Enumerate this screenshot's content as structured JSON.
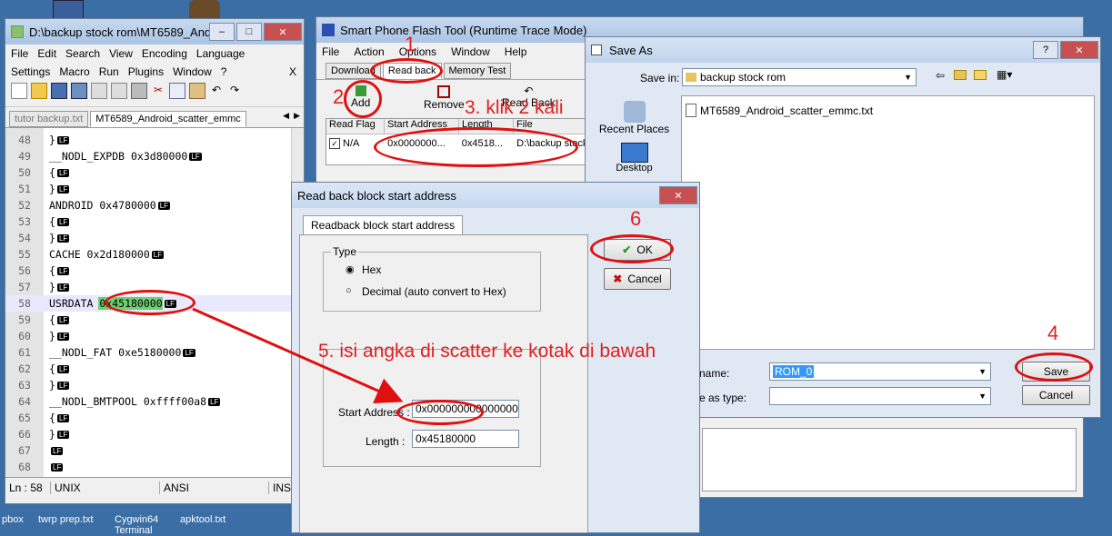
{
  "desktop": {
    "taskbar_labels": [
      "pbox",
      "twrp prep.txt",
      "Cygwin64 Terminal",
      "apktool.txt"
    ]
  },
  "notepad": {
    "title": "D:\\backup stock rom\\MT6589_And...",
    "menu_row1": [
      "File",
      "Edit",
      "Search",
      "View",
      "Encoding",
      "Language"
    ],
    "menu_row2": [
      "Settings",
      "Macro",
      "Run",
      "Plugins",
      "Window",
      "?"
    ],
    "menu_close": "X",
    "tabs": [
      "tutor backup.txt",
      "MT6589_Android_scatter_emmc"
    ],
    "lines": [
      {
        "num": "48",
        "text": "}",
        "lf": "LF"
      },
      {
        "num": "49",
        "text": "__NODL_EXPDB 0x3d80000",
        "lf": "LF"
      },
      {
        "num": "50",
        "text": "{",
        "lf": "LF"
      },
      {
        "num": "51",
        "text": "}",
        "lf": "LF"
      },
      {
        "num": "52",
        "text": "ANDROID 0x4780000",
        "lf": "LF"
      },
      {
        "num": "53",
        "text": "{",
        "lf": "LF"
      },
      {
        "num": "54",
        "text": "}",
        "lf": "LF"
      },
      {
        "num": "55",
        "text": "CACHE 0x2d180000",
        "lf": "LF"
      },
      {
        "num": "56",
        "text": "{",
        "lf": "LF"
      },
      {
        "num": "57",
        "text": "}",
        "lf": "LF"
      },
      {
        "num": "58",
        "text": "USRDATA 0x45180000",
        "lf": "LF"
      },
      {
        "num": "59",
        "text": "{",
        "lf": "LF"
      },
      {
        "num": "60",
        "text": "}",
        "lf": "LF"
      },
      {
        "num": "61",
        "text": "__NODL_FAT 0xe5180000",
        "lf": "LF"
      },
      {
        "num": "62",
        "text": "{",
        "lf": "LF"
      },
      {
        "num": "63",
        "text": "}",
        "lf": "LF"
      },
      {
        "num": "64",
        "text": "__NODL_BMTPOOL 0xffff00a8",
        "lf": "LF"
      },
      {
        "num": "65",
        "text": "{",
        "lf": "LF"
      },
      {
        "num": "66",
        "text": "}",
        "lf": "LF"
      },
      {
        "num": "67",
        "text": "",
        "lf": "LF"
      },
      {
        "num": "68",
        "text": "",
        "lf": "LF"
      }
    ],
    "status": {
      "ln": "Ln : 58",
      "eol": "UNIX",
      "enc": "ANSI",
      "mode": "INS"
    }
  },
  "flashtool": {
    "title": "Smart Phone Flash Tool (Runtime Trace Mode)",
    "menu": [
      "File",
      "Action",
      "Options",
      "Window",
      "Help"
    ],
    "tabs": [
      "Download",
      "Read back",
      "Memory Test"
    ],
    "toolbar": {
      "add": "Add",
      "remove": "Remove",
      "read_back": "Read Back"
    },
    "columns": [
      "Read Flag",
      "Start Address",
      "Length",
      "File"
    ],
    "row": {
      "flag": "N/A",
      "start": "0x0000000...",
      "length": "0x4518...",
      "file": "D:\\backup stock"
    }
  },
  "saveas": {
    "title": "Save As",
    "save_in_label": "Save in:",
    "save_in_value": "backup stock rom",
    "places": [
      "Recent Places",
      "Desktop"
    ],
    "file_item": "MT6589_Android_scatter_emmc.txt",
    "filename_label": "name:",
    "filename_value": "ROM_0",
    "filetype_label": "e as type:",
    "save_label": "Save",
    "cancel_label": "Cancel"
  },
  "readback_dialog": {
    "title": "Read back block start address",
    "tab": "Readback block start address",
    "type_label": "Type",
    "hex_label": "Hex",
    "decimal_label": "Decimal (auto convert to Hex)",
    "start_label": "Start Address :",
    "start_value": "0x0000000000000000",
    "length_label": "Length :",
    "length_value": "0x45180000",
    "ok_label": "OK",
    "cancel_label": "Cancel"
  },
  "annotations": {
    "n1": "1",
    "n2": "2",
    "n3": "3. klik 2 kali",
    "n4": "4",
    "n5": "5. isi angka di scatter ke kotak di bawah",
    "n6": "6"
  }
}
